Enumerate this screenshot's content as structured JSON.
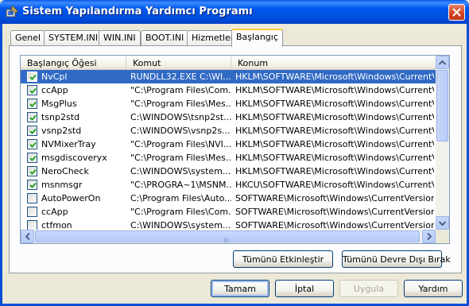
{
  "window": {
    "title": "Sistem Yapılandırma Yardımcı Programı"
  },
  "tabs": [
    {
      "label": "Genel"
    },
    {
      "label": "SYSTEM.INI"
    },
    {
      "label": "WIN.INI"
    },
    {
      "label": "BOOT.INI"
    },
    {
      "label": "Hizmetler"
    },
    {
      "label": "Başlangıç",
      "active": true
    }
  ],
  "list": {
    "columns": [
      "Başlangıç Öğesi",
      "Komut",
      "Konum"
    ],
    "rows": [
      {
        "name": "NvCpl",
        "checked": true,
        "selected": true,
        "command": "RUNDLL32.EXE C:\\WI...",
        "location": "HKLM\\SOFTWARE\\Microsoft\\Windows\\CurrentVer..."
      },
      {
        "name": "ccApp",
        "checked": true,
        "command": "\"C:\\Program Files\\Com...",
        "location": "HKLM\\SOFTWARE\\Microsoft\\Windows\\CurrentVer..."
      },
      {
        "name": "MsgPlus",
        "checked": true,
        "command": "\"C:\\Program Files\\Mes...",
        "location": "HKLM\\SOFTWARE\\Microsoft\\Windows\\CurrentVer..."
      },
      {
        "name": "tsnp2std",
        "checked": true,
        "command": "C:\\WINDOWS\\tsnp2st...",
        "location": "HKLM\\SOFTWARE\\Microsoft\\Windows\\CurrentVer..."
      },
      {
        "name": "vsnp2std",
        "checked": true,
        "command": "C:\\WINDOWS\\vsnp2s...",
        "location": "HKLM\\SOFTWARE\\Microsoft\\Windows\\CurrentVer..."
      },
      {
        "name": "NVMixerTray",
        "checked": true,
        "command": "\"C:\\Program Files\\NVI...",
        "location": "HKLM\\SOFTWARE\\Microsoft\\Windows\\CurrentVer..."
      },
      {
        "name": "msgdiscoveryx",
        "checked": true,
        "command": "\"C:\\Program Files\\Mes...",
        "location": "HKLM\\SOFTWARE\\Microsoft\\Windows\\CurrentVer..."
      },
      {
        "name": "NeroCheck",
        "checked": true,
        "command": "C:\\WINDOWS\\system...",
        "location": "HKLM\\SOFTWARE\\Microsoft\\Windows\\CurrentVer..."
      },
      {
        "name": "msnmsgr",
        "checked": true,
        "command": "\"C:\\PROGRA~1\\MSNM...",
        "location": "HKCU\\SOFTWARE\\Microsoft\\Windows\\CurrentVer..."
      },
      {
        "name": "AutoPowerOn",
        "checked": false,
        "command": "C:\\Program Files\\Auto...",
        "location": "SOFTWARE\\Microsoft\\Windows\\CurrentVersion\\Ru..."
      },
      {
        "name": "ccApp",
        "checked": false,
        "command": "\"C:\\Program Files\\Com...",
        "location": "SOFTWARE\\Microsoft\\Windows\\CurrentVersion\\Ru..."
      },
      {
        "name": "ctfmon",
        "checked": false,
        "command": "C:\\WINDOWS\\system...",
        "location": "SOFTWARE\\Microsoft\\Windows\\CurrentVersion\\Ru..."
      }
    ]
  },
  "buttons": {
    "enable_all": "Tümünü Etkinleştir",
    "disable_all": "Tümünü Devre Dışı Bırak",
    "ok": "Tamam",
    "cancel": "İptal",
    "apply": "Uygula",
    "help": "Yardım"
  },
  "icons": {
    "title": "msconfig-icon",
    "close": "close-icon",
    "check": "check-icon",
    "scroll_up": "arrow-up-icon",
    "scroll_down": "arrow-down-icon",
    "scroll_left": "arrow-left-icon",
    "scroll_right": "arrow-right-icon"
  },
  "colors": {
    "titlebar": "#0054e3",
    "selection": "#316ac5",
    "close_button": "#d4421f",
    "check": "#21a121",
    "active_tab_accent": "#ffc83c"
  }
}
